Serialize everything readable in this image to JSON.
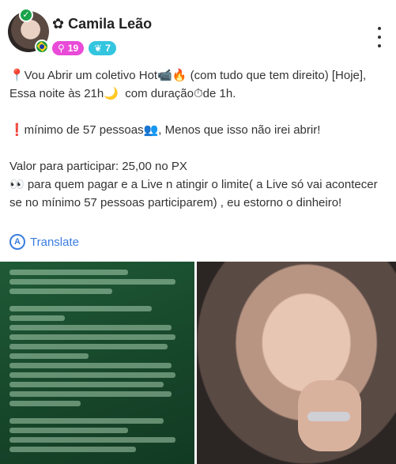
{
  "post_header": {
    "author_icon": "flower-icon",
    "author_name": "✿ Camila Leão",
    "level_badge": "19",
    "reputation_badge": "7",
    "verified_icon": "check-badge-icon",
    "country_icon": "brazil-flag-icon",
    "menu_icon": "more-vertical-icon"
  },
  "post_body": {
    "line_1": "📍Vou Abrir um coletivo Hot📹🔥 (com tudo que tem direito) [Hoje], Essa noite às 21h🌙  com duração⏱de 1h.",
    "line_2": "❗mínimo de 57 pessoas👥, Menos que isso não irei abrir!",
    "line_3": "Valor para participar: 25,00 no PX\n👀 para quem pagar e a Live n atingir o limite( a Live só vai acontecer se no mínimo 57 pessoas participarem) , eu estorno o dinheiro!"
  },
  "translate": {
    "label": "Translate",
    "icon": "translate-icon"
  },
  "attachments": {
    "left_image": "chat-screenshot-image",
    "right_image": "selfie-image"
  },
  "colors": {
    "level_badge": "#e94ad8",
    "reputation_badge": "#34c5df",
    "verified": "#1aa34a",
    "link": "#3a7de0"
  }
}
